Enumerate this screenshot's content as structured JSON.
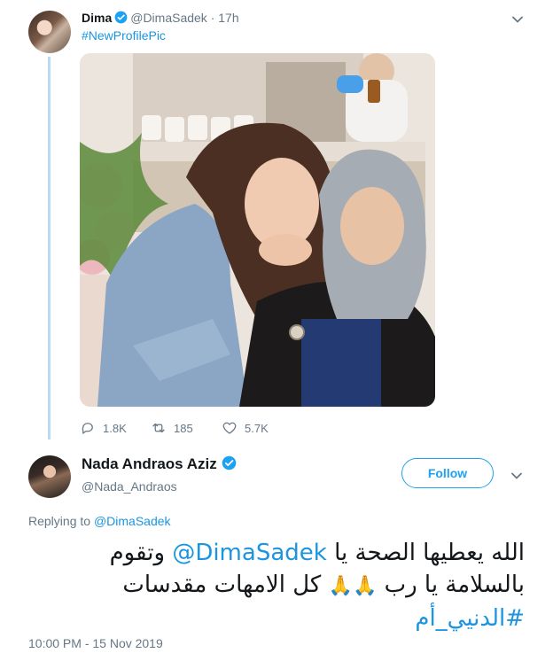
{
  "tweet": {
    "author_name": "Dima",
    "author_handle": "@DimaSadek",
    "separator": "·",
    "time_ago": "17h",
    "text_hashtag": "#NewProfilePic",
    "stats": {
      "replies": "1.8K",
      "retweets": "185",
      "likes": "5.7K"
    }
  },
  "reply": {
    "author_name": "Nada Andraos Aziz",
    "author_handle": "@Nada_Andraos",
    "follow_label": "Follow",
    "replying_prefix": "Replying to",
    "replying_to": "@DimaSadek",
    "line1_a": "الله يعطيها الصحة يا",
    "line1_mention": "@DimaSadek",
    "line1_b": "وتقوم",
    "line2_a": "بالسلامة يا رب",
    "line2_emoji": "🙏🙏",
    "line2_b": "كل الامهات مقدسات",
    "line3_hashtag": "#الدنيي_أم",
    "timestamp": "10:00 PM - 15 Nov 2019"
  },
  "colors": {
    "link": "#1b95e0",
    "accent": "#1da1f2",
    "muted": "#657786",
    "thread": "#b8dbf3"
  },
  "icons": [
    "verified-badge-icon",
    "chevron-down-icon",
    "reply-icon",
    "retweet-icon",
    "like-icon"
  ]
}
